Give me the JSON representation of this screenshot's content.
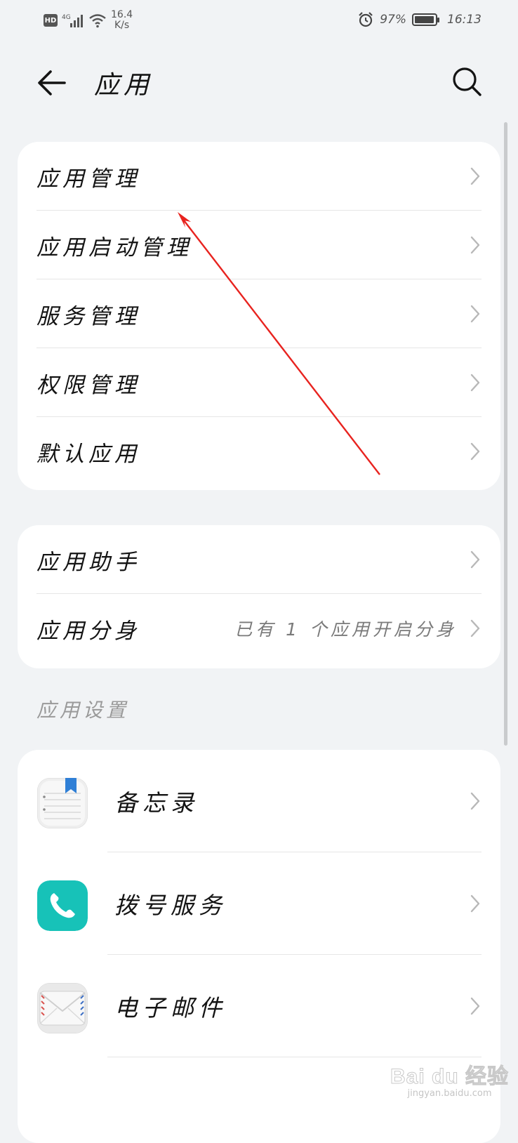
{
  "status_bar": {
    "hd": "HD",
    "network": "4G",
    "speed_value": "16.4",
    "speed_unit": "K/s",
    "battery_percent": "97%",
    "battery_level": 0.97,
    "time": "16:13"
  },
  "header": {
    "title": "应用"
  },
  "card1": {
    "items": [
      {
        "label": "应用管理"
      },
      {
        "label": "应用启动管理"
      },
      {
        "label": "服务管理"
      },
      {
        "label": "权限管理"
      },
      {
        "label": "默认应用"
      }
    ]
  },
  "card2": {
    "items": [
      {
        "label": "应用助手",
        "value": ""
      },
      {
        "label": "应用分身",
        "value": "已有 1 个应用开启分身"
      }
    ]
  },
  "app_settings": {
    "section_title": "应用设置",
    "apps": [
      {
        "label": "备忘录",
        "icon": "notepad-icon"
      },
      {
        "label": "拨号服务",
        "icon": "phone-icon"
      },
      {
        "label": "电子邮件",
        "icon": "mail-envelope-icon"
      }
    ]
  },
  "colors": {
    "background": "#f1f3f5",
    "card": "#ffffff",
    "annotation_arrow": "#e8231f",
    "dialer_icon": "#17c2b8",
    "notes_bookmark": "#2f7fd6"
  },
  "watermark": {
    "main": "Bai du 经验",
    "sub": "jingyan.baidu.com"
  }
}
